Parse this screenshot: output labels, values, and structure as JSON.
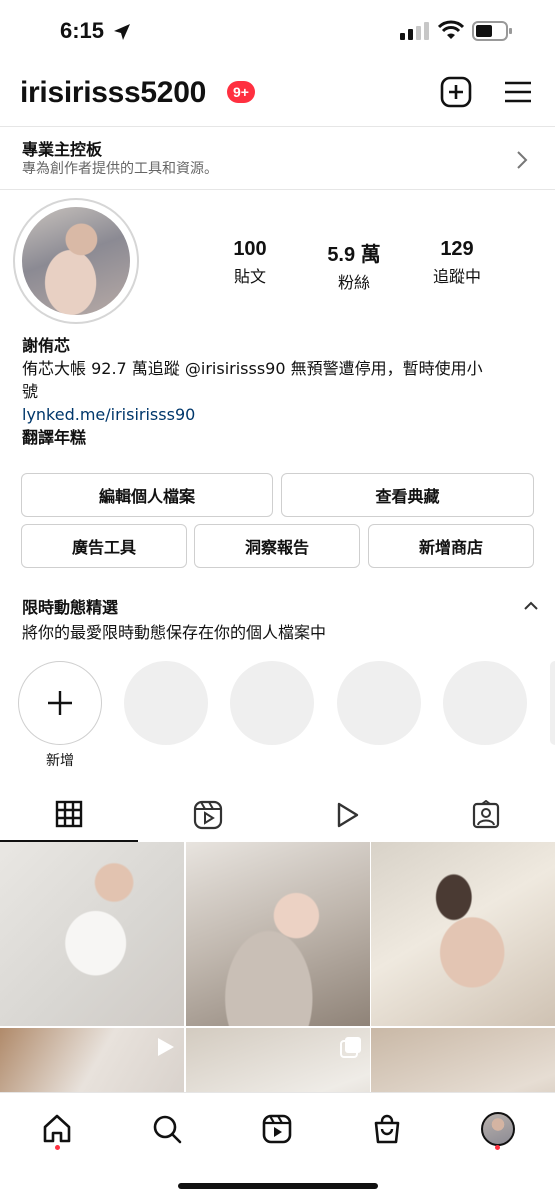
{
  "status_bar": {
    "time": "6:15"
  },
  "header": {
    "username": "irisirisss5200",
    "notif_count": "9+"
  },
  "pro_dashboard": {
    "title": "專業主控板",
    "subtitle": "專為創作者提供的工具和資源。"
  },
  "profile": {
    "stats": [
      {
        "value": "100",
        "label": "貼文"
      },
      {
        "value": "5.9 萬",
        "label": "粉絲"
      },
      {
        "value": "129",
        "label": "追蹤中"
      }
    ],
    "name": "謝侑芯",
    "bio_line1": "侑芯大帳 92.7 萬追蹤 @irisirisss90 無預警遭停用，暫時使用小",
    "bio_line2": "號",
    "link": "lynked.me/irisirisss90",
    "translate": "翻譯年糕"
  },
  "buttons": {
    "edit_profile": "編輯個人檔案",
    "saved": "查看典藏",
    "ad_tools": "廣告工具",
    "insights": "洞察報告",
    "add_shop": "新增商店"
  },
  "highlights": {
    "title": "限時動態精選",
    "subtitle": "將你的最愛限時動態保存在你的個人檔案中",
    "new_label": "新增"
  },
  "tabs": [
    "grid-icon",
    "reels-icon",
    "video-icon",
    "tagged-icon"
  ],
  "colors": {
    "accent_red": "#ff3040",
    "link": "#00376b"
  }
}
